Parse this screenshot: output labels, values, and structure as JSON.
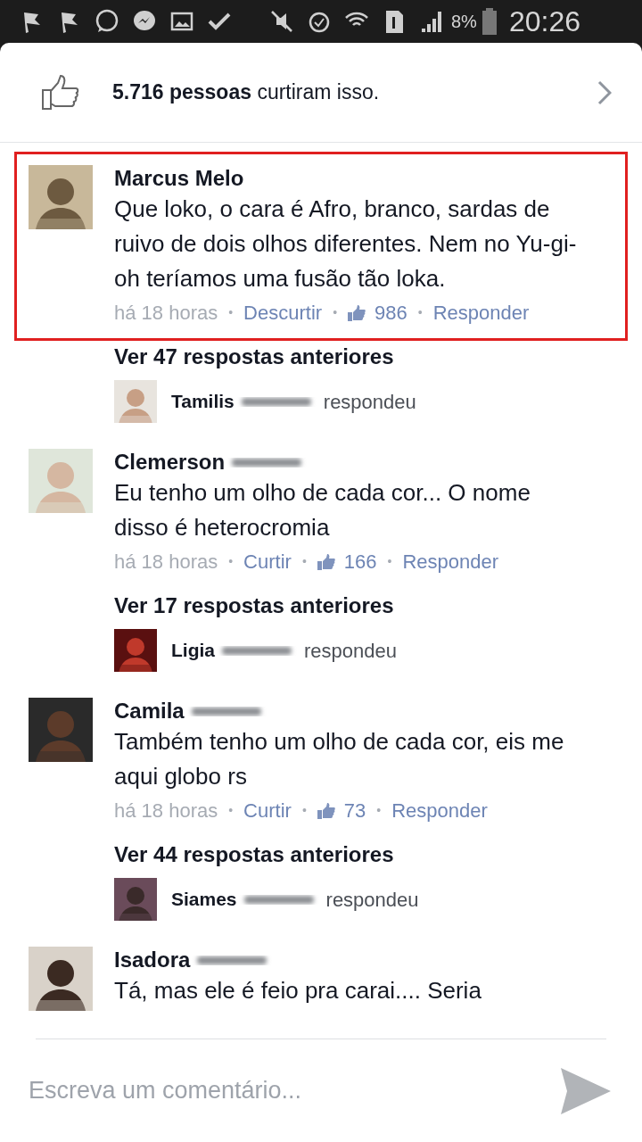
{
  "status_bar": {
    "battery": "8%",
    "time": "20:26"
  },
  "likes": {
    "summary": "**5.716 pessoas** curtiram isso."
  },
  "comments": [
    {
      "author": "Marcus Melo",
      "redacted": false,
      "highlighted": true,
      "text": "Que loko, o cara é Afro, branco, sardas de ruivo de dois olhos diferentes. Nem no Yu-gi-oh teríamos uma fusão tão loka.",
      "meta": [
        {
          "kind": "time",
          "text": "há 18 horas"
        },
        {
          "kind": "dot",
          "text": "•"
        },
        {
          "kind": "link",
          "text": "Descurtir"
        },
        {
          "kind": "dot",
          "text": "•"
        },
        {
          "kind": "likes",
          "text": "986"
        },
        {
          "kind": "dot",
          "text": "•"
        },
        {
          "kind": "link",
          "text": "Responder"
        }
      ],
      "more_replies": "Ver 47 respostas anteriores",
      "last_reply": {
        "author": "Tamilis",
        "redacted": true,
        "verb": "respondeu"
      }
    },
    {
      "author": "Clemerson",
      "redacted": true,
      "highlighted": false,
      "text": "Eu tenho um olho de cada cor... O nome disso é heterocromia",
      "meta": [
        {
          "kind": "time",
          "text": "há 18 horas"
        },
        {
          "kind": "dot",
          "text": "•"
        },
        {
          "kind": "link",
          "text": "Curtir"
        },
        {
          "kind": "dot",
          "text": "•"
        },
        {
          "kind": "likes",
          "text": "166"
        },
        {
          "kind": "dot",
          "text": "•"
        },
        {
          "kind": "link",
          "text": "Responder"
        }
      ],
      "more_replies": "Ver 17 respostas anteriores",
      "last_reply": {
        "author": "Ligia",
        "redacted": true,
        "verb": "respondeu"
      }
    },
    {
      "author": "Camila",
      "redacted": true,
      "highlighted": false,
      "text": "Também tenho um olho de cada cor, eis me aqui globo rs",
      "meta": [
        {
          "kind": "time",
          "text": "há 18 horas"
        },
        {
          "kind": "dot",
          "text": "•"
        },
        {
          "kind": "link",
          "text": "Curtir"
        },
        {
          "kind": "dot",
          "text": "•"
        },
        {
          "kind": "likes",
          "text": "73"
        },
        {
          "kind": "dot",
          "text": "•"
        },
        {
          "kind": "link",
          "text": "Responder"
        }
      ],
      "more_replies": "Ver 44 respostas anteriores",
      "last_reply": {
        "author": "Siames",
        "redacted": true,
        "verb": "respondeu"
      }
    },
    {
      "author": "Isadora",
      "redacted": true,
      "highlighted": false,
      "text": "Tá, mas ele é feio pra carai.... Seria"
    }
  ],
  "composer": {
    "placeholder": "Escreva um comentário..."
  }
}
